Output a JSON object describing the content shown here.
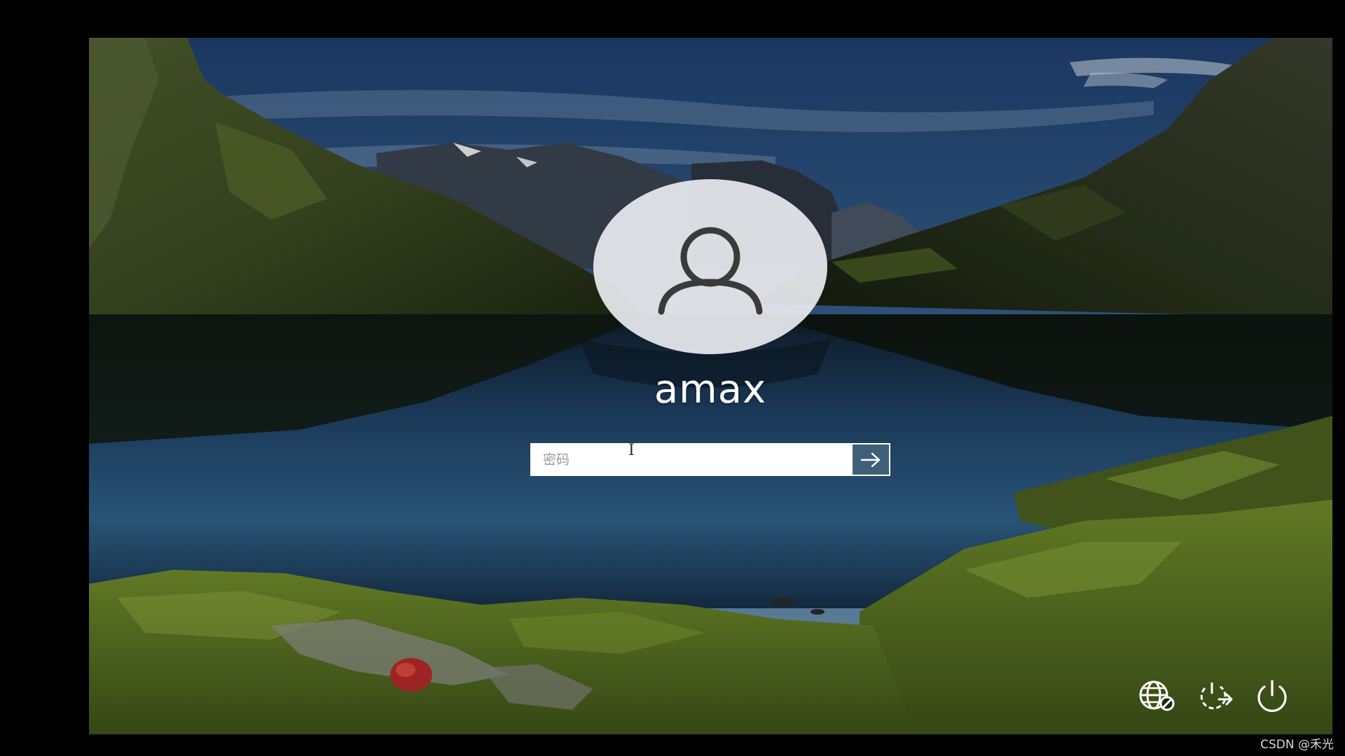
{
  "login": {
    "username": "amax",
    "password_placeholder": "密码",
    "submit_icon": "arrow-right-icon",
    "avatar_icon": "user-icon"
  },
  "bottom_bar": {
    "icons": [
      "network-icon",
      "ease-of-access-icon",
      "power-icon"
    ]
  },
  "watermark": "CSDN @禾光",
  "colors": {
    "submit_button": "#3f6078",
    "input_background": "#ffffff",
    "avatar_background": "#e8eaee"
  }
}
